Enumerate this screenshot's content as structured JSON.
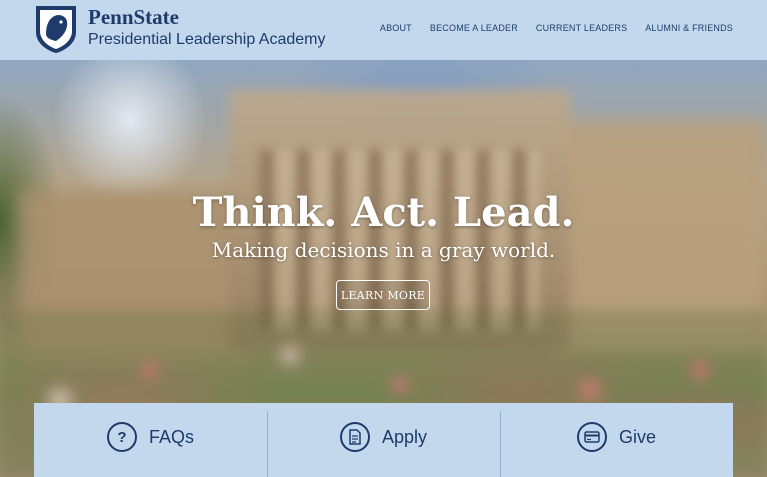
{
  "header": {
    "brand_name": "PennState",
    "brand_sub": "Presidential Leadership Academy",
    "nav": [
      "ABOUT",
      "BECOME A LEADER",
      "CURRENT LEADERS",
      "ALUMNI & FRIENDS"
    ]
  },
  "hero": {
    "headline": "Think. Act. Lead.",
    "tagline": "Making decisions in a gray world.",
    "cta": "LEARN MORE"
  },
  "panel": {
    "items": [
      {
        "label": "FAQs",
        "icon": "question-icon"
      },
      {
        "label": "Apply",
        "icon": "document-icon"
      },
      {
        "label": "Give",
        "icon": "credit-card-icon"
      }
    ]
  },
  "colors": {
    "header_bg": "#c3d8ec",
    "brand": "#1e3b6c",
    "text_white": "#ffffff"
  }
}
